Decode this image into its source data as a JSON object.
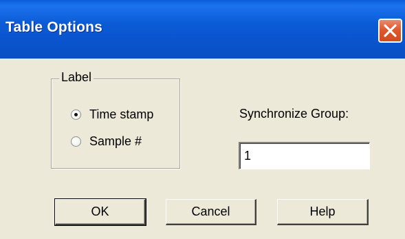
{
  "window": {
    "title": "Table Options",
    "close_icon": "close-x-icon"
  },
  "label_group": {
    "title": "Label",
    "options": [
      {
        "label": "Time stamp",
        "checked": true
      },
      {
        "label": "Sample #",
        "checked": false
      }
    ]
  },
  "sync_group": {
    "label": "Synchronize Group:",
    "value": "1"
  },
  "buttons": {
    "ok": "OK",
    "cancel": "Cancel",
    "help": "Help"
  },
  "colors": {
    "titlebar": "#0a53cc",
    "close_button": "#e0582e",
    "dialog_background": "#ece9d8"
  }
}
